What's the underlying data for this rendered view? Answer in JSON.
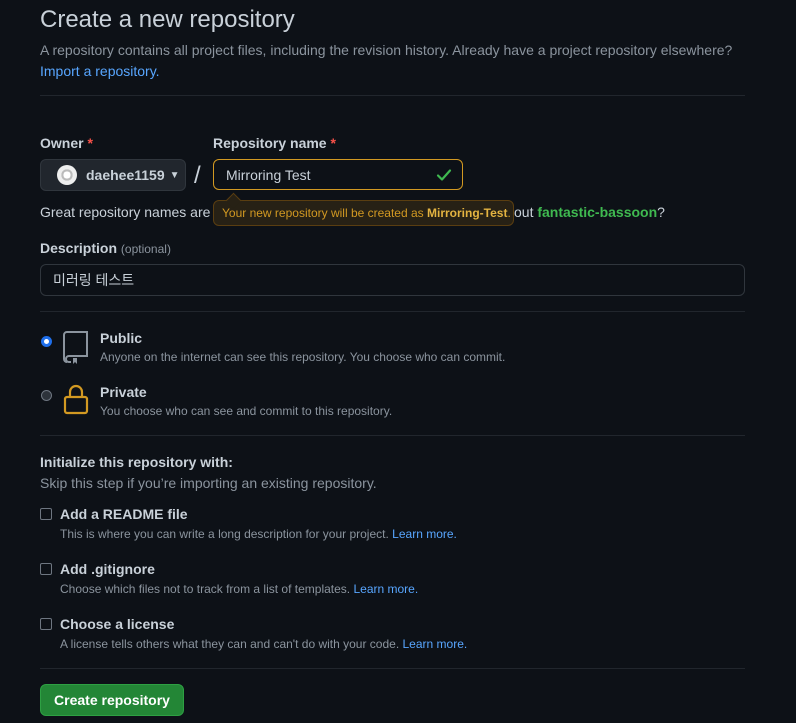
{
  "page": {
    "title": "Create a new repository",
    "subtitle": "A repository contains all project files, including the revision history. Already have a project repository elsewhere?",
    "import_link": "Import a repository."
  },
  "owner": {
    "label": "Owner",
    "required_mark": "*",
    "value": "daehee1159"
  },
  "separator": "/",
  "repo_name": {
    "label": "Repository name",
    "required_mark": "*",
    "value": "Mirroring Test",
    "tooltip_prefix": "Your new repository will be created as ",
    "tooltip_name": "Mirroring-Test",
    "tooltip_suffix": "."
  },
  "suggestion": {
    "prefix": "Great repository names are s",
    "tail_prefix": "out ",
    "suggested_name": "fantastic-bassoon",
    "tail_suffix": "?"
  },
  "description": {
    "label": "Description",
    "optional": "(optional)",
    "value": "미러링 테스트"
  },
  "visibility": {
    "public": {
      "title": "Public",
      "desc": "Anyone on the internet can see this repository. You choose who can commit.",
      "selected": true
    },
    "private": {
      "title": "Private",
      "desc": "You choose who can see and commit to this repository.",
      "selected": false
    }
  },
  "init": {
    "title": "Initialize this repository with:",
    "subtitle": "Skip this step if you’re importing an existing repository.",
    "readme": {
      "title": "Add a README file",
      "desc": "This is where you can write a long description for your project.",
      "learn": "Learn more."
    },
    "gitignore": {
      "title": "Add .gitignore",
      "desc": "Choose which files not to track from a list of templates.",
      "learn": "Learn more."
    },
    "license": {
      "title": "Choose a license",
      "desc": "A license tells others what they can and can't do with your code.",
      "learn": "Learn more."
    }
  },
  "create_button": "Create repository",
  "colors": {
    "accent_green": "#238636",
    "link": "#58a6ff",
    "warning": "#d29922",
    "background": "#0d1117"
  },
  "icons": {
    "public": "repo-icon",
    "private": "lock-icon",
    "valid": "check-icon",
    "dropdown": "triangle-down-icon"
  }
}
